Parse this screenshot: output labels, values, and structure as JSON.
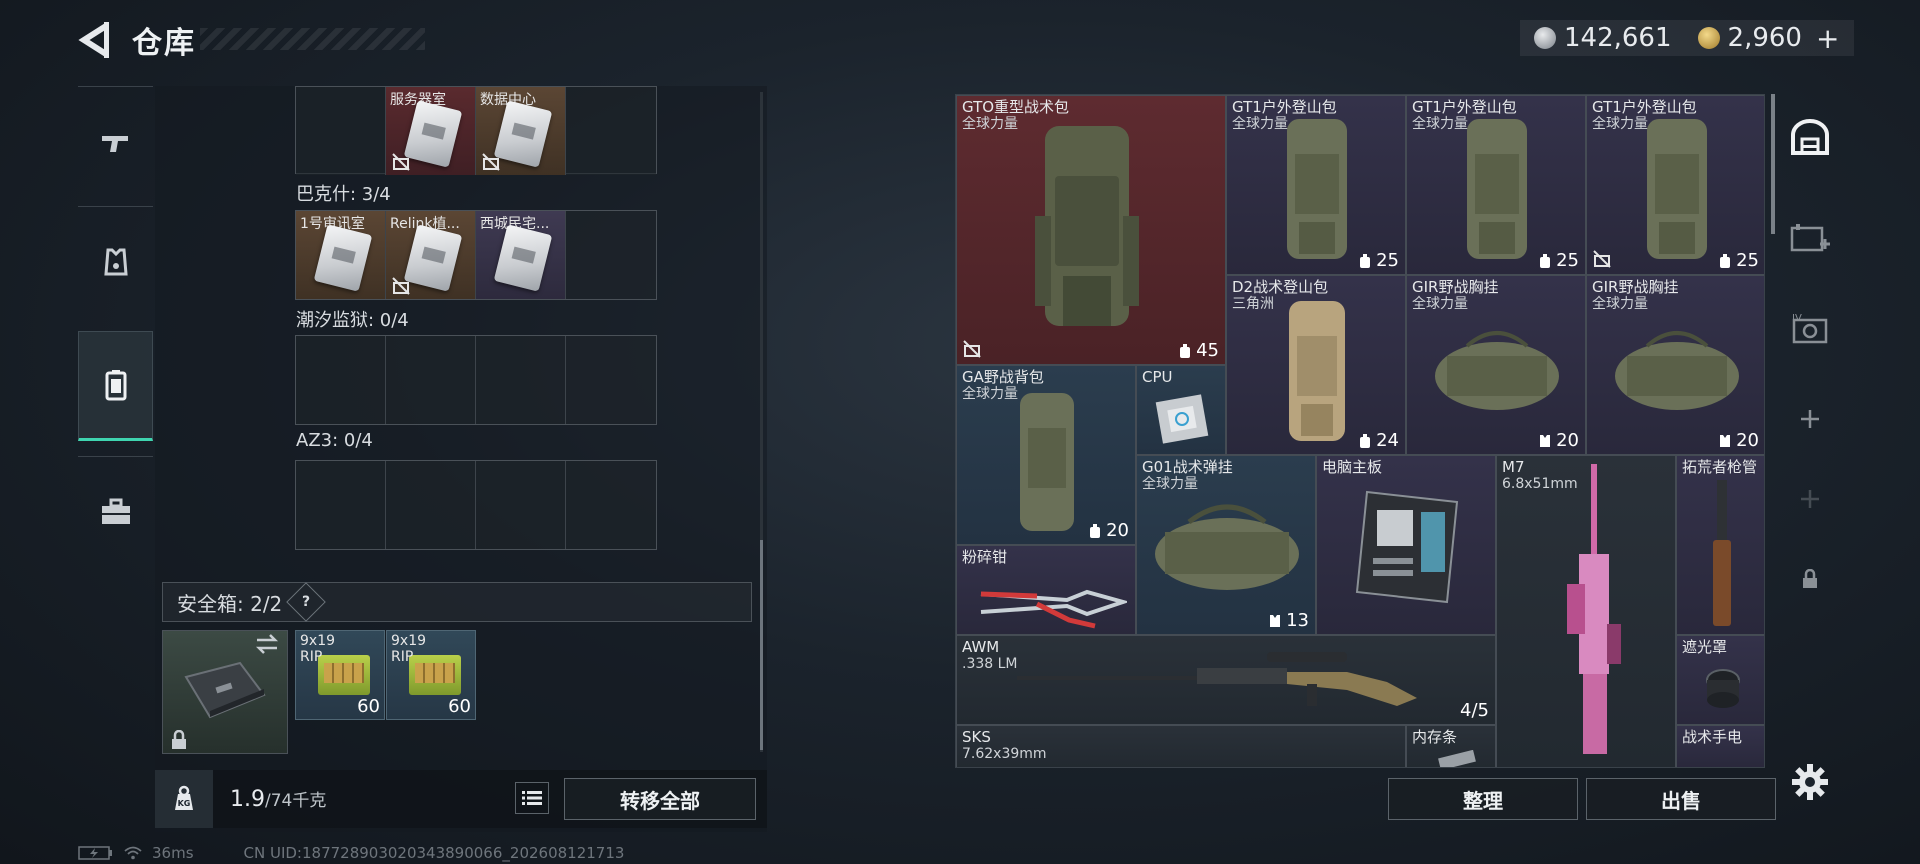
{
  "header": {
    "title": "仓库",
    "currency": {
      "silver": "142,661",
      "gold": "2,960"
    },
    "plus_label": "+"
  },
  "left_tabs": [
    {
      "name": "weapons",
      "icon": "gun-icon"
    },
    {
      "name": "armor",
      "icon": "vest-icon"
    },
    {
      "name": "keycards",
      "icon": "keycard-case-icon",
      "active": true
    },
    {
      "name": "toolbox",
      "icon": "toolbox-icon"
    }
  ],
  "keycard_groups": [
    {
      "label": "",
      "cells": [
        {
          "label": "服务器室",
          "color": "red",
          "locked": true
        },
        {
          "label": "数据中心",
          "color": "brown",
          "locked": true
        },
        {
          "label": "",
          "color": "empty"
        },
        {
          "label": "",
          "color": "empty"
        }
      ]
    },
    {
      "label": "巴克什: 3/4",
      "cells": [
        {
          "label": "1号审讯室",
          "color": "brown"
        },
        {
          "label": "Relink植...",
          "color": "brown",
          "locked": true
        },
        {
          "label": "西城民宅...",
          "color": "purple"
        },
        {
          "label": "",
          "color": "empty"
        }
      ]
    },
    {
      "label": "潮汐监狱: 0/4",
      "cells": []
    },
    {
      "label": "AZ3: 0/4",
      "cells": []
    }
  ],
  "safebox": {
    "label": "安全箱: 2/2",
    "help": "?",
    "ammo": [
      {
        "label1": "9x19",
        "label2": "RIP",
        "count": "60"
      },
      {
        "label1": "9x19",
        "label2": "RIP",
        "count": "60"
      }
    ]
  },
  "weight": {
    "current": "1.9",
    "max": "/74千克"
  },
  "buttons": {
    "transfer_all": "转移全部",
    "sort": "整理",
    "sell": "出售"
  },
  "status": {
    "ping": "36ms",
    "uid": "CN UID:187728903020343890066_202608121713"
  },
  "stash_items": {
    "gto": {
      "name": "GTO重型战术包",
      "sub": "全球力量",
      "cap": "45"
    },
    "gt1_a": {
      "name": "GT1户外登山包",
      "sub": "全球力量",
      "cap": "25"
    },
    "gt1_b": {
      "name": "GT1户外登山包",
      "sub": "全球力量",
      "cap": "25"
    },
    "gt1_c": {
      "name": "GT1户外登山包",
      "sub": "全球力量",
      "cap": "25"
    },
    "d2": {
      "name": "D2战术登山包",
      "sub": "三角洲",
      "cap": "24"
    },
    "gir_a": {
      "name": "GIR野战胸挂",
      "sub": "全球力量",
      "cap": "20"
    },
    "gir_b": {
      "name": "GIR野战胸挂",
      "sub": "全球力量",
      "cap": "20"
    },
    "ga": {
      "name": "GA野战背包",
      "sub": "全球力量",
      "cap": "20"
    },
    "cpu": {
      "name": "CPU"
    },
    "g01": {
      "name": "G01战术弹挂",
      "sub": "全球力量",
      "cap": "13"
    },
    "motherboard": {
      "name": "电脑主板"
    },
    "m7": {
      "name": "M7",
      "sub": "6.8x51mm"
    },
    "barrel": {
      "name": "拓荒者枪管"
    },
    "pliers": {
      "name": "粉碎钳"
    },
    "awm": {
      "name": "AWM",
      "sub": ".338 LM",
      "cap": "4/5"
    },
    "shade": {
      "name": "遮光罩"
    },
    "sks": {
      "name": "SKS",
      "sub": "7.62x39mm"
    },
    "ram": {
      "name": "内存条"
    },
    "flashlight": {
      "name": "战术手电"
    }
  },
  "colors": {
    "accent": "#3fd5b0",
    "red_rarity": "#5e2b30",
    "purple_rarity": "#34324a",
    "blue_rarity": "#2b3d4e",
    "gold_rarity": "#5b4634"
  }
}
